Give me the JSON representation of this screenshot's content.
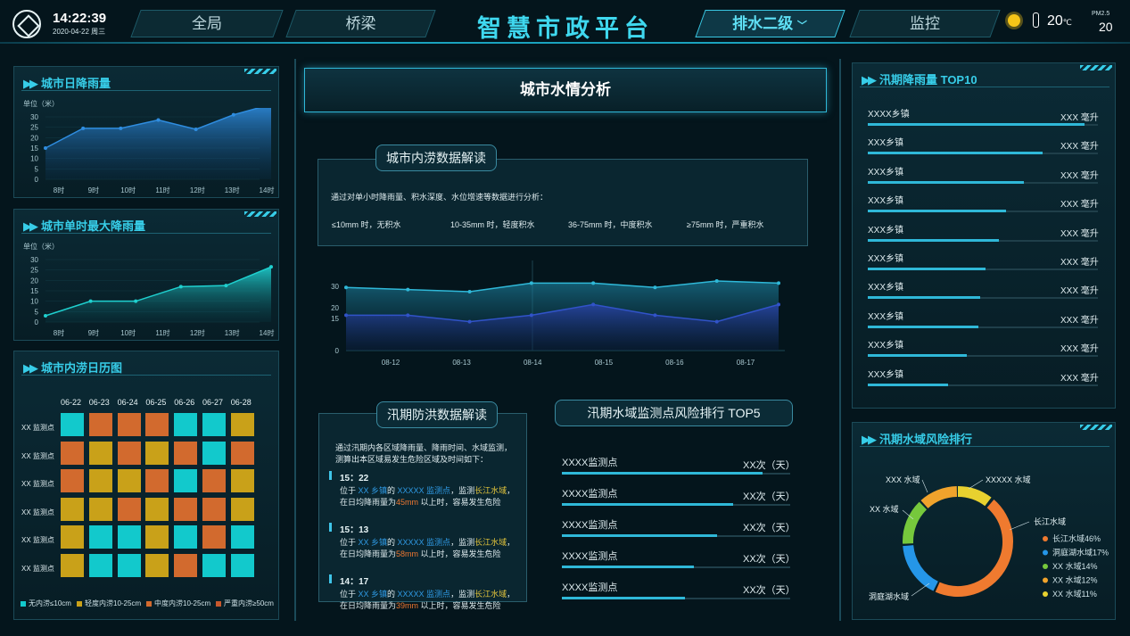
{
  "header": {
    "time": "14:22:39",
    "date": "2020-04-22 周三",
    "tabs": [
      "全局",
      "桥梁"
    ],
    "title": "智慧市政平台",
    "dropdown": "排水二级",
    "tab_right": "监控",
    "temp": "20",
    "temp_unit": "℃",
    "pm_label": "PM2.5",
    "pm_value": "20"
  },
  "rain_daily": {
    "title": "城市日降雨量",
    "unit": "单位（米）",
    "yticks": [
      "30",
      "25",
      "20",
      "15",
      "10",
      "5",
      "0"
    ],
    "x": [
      "8时",
      "9时",
      "10时",
      "11时",
      "12时",
      "13时",
      "14时"
    ],
    "values": [
      15,
      24.5,
      24.5,
      28.5,
      24,
      31,
      36
    ]
  },
  "rain_hourly": {
    "title": "城市单时最大降雨量",
    "unit": "单位（米）",
    "yticks": [
      "30",
      "25",
      "20",
      "15",
      "10",
      "5",
      "0"
    ],
    "x": [
      "8时",
      "9时",
      "10时",
      "11时",
      "12时",
      "13时",
      "14时"
    ],
    "values": [
      3,
      10,
      10,
      17,
      17.5,
      26.5
    ]
  },
  "calendar": {
    "title": "城市内涝日历图",
    "days": [
      "06-22",
      "06-23",
      "06-24",
      "06-25",
      "06-26",
      "06-27",
      "06-28"
    ],
    "rows": [
      "XX 监测点",
      "XX 监测点",
      "XX 监测点",
      "XX 监测点",
      "XX 监测点",
      "XX 监测点"
    ],
    "grid": [
      [
        0,
        2,
        2,
        2,
        0,
        0,
        1
      ],
      [
        2,
        1,
        2,
        1,
        2,
        0,
        2
      ],
      [
        2,
        1,
        1,
        2,
        0,
        2,
        1
      ],
      [
        1,
        1,
        2,
        1,
        2,
        2,
        1
      ],
      [
        1,
        0,
        0,
        1,
        0,
        2,
        0
      ],
      [
        1,
        0,
        0,
        1,
        2,
        0,
        0
      ]
    ],
    "colors": [
      "#12c9cc",
      "#c9a119",
      "#d26a2e",
      "#c7582d"
    ],
    "legend": [
      "无内涝≤10cm",
      "轻度内涝10-25cm",
      "中度内涝10-25cm",
      "严重内涝≥50cm"
    ],
    "legend_colors": [
      "#12c9cc",
      "#c9a119",
      "#d26a2e",
      "#c7582d"
    ]
  },
  "center": {
    "title": "城市水情分析",
    "analysis_tag": "城市内涝数据解读",
    "analysis_text": "通过对单小时降雨量、积水深度、水位增速等数据进行分析：",
    "levels": [
      "≤10mm 时，无积水",
      "10-35mm 时，轻度积水",
      "36-75mm 时，中度积水",
      "≥75mm 时，严重积水"
    ]
  },
  "center_chart": {
    "type": "line",
    "x": [
      "08-12",
      "08-13",
      "08-14",
      "08-15",
      "08-16",
      "08-17"
    ],
    "yticks": [
      "30",
      "20",
      "15",
      "0"
    ],
    "series": [
      {
        "values": [
          29.5,
          28.5,
          27.5,
          31.5,
          31.5,
          29.5,
          32.5,
          31.5
        ]
      },
      {
        "values": [
          16.5,
          16.5,
          13.5,
          16.5,
          21.5,
          16.5,
          13.5,
          21.5
        ]
      }
    ],
    "colors": [
      "#2fb8d8",
      "#3153c9"
    ]
  },
  "flood": {
    "tag": "汛期防洪数据解读",
    "intro1": "通过汛期内各区域降雨量、降雨时间、水域监测，",
    "intro2": "测算出本区域易发生危险区域及时间如下：",
    "events": [
      {
        "time": "15：22",
        "a": "位于 ",
        "town": "XX 乡镇",
        "b": "的 ",
        "point": "XXXXX 监测点",
        "c": "，监测",
        "river": "长江水域",
        "d": "，",
        "e": "在日均降雨量为",
        "mm": "45mm",
        "f": " 以上时，容易发生危险"
      },
      {
        "time": "15：13",
        "a": "位于 ",
        "town": "XX 乡镇",
        "b": "的 ",
        "point": "XXXXX 监测点",
        "c": "，监测",
        "river": "长江水域",
        "d": "，",
        "e": "在日均降雨量为",
        "mm": "58mm",
        "f": " 以上时，容易发生危险"
      },
      {
        "time": "14：17",
        "a": "位于 ",
        "town": "XX 乡镇",
        "b": "的 ",
        "point": "XXXXX 监测点",
        "c": "，监测",
        "river": "长江水域",
        "d": "，",
        "e": "在日均降雨量为",
        "mm": "39mm",
        "f": " 以上时，容易发生危险"
      }
    ]
  },
  "risk_top5": {
    "tag": "汛期水域监测点风险排行 TOP5",
    "items": [
      {
        "name": "XXXX监测点",
        "value": "XX次（天）",
        "pct": 0.88
      },
      {
        "name": "XXXX监测点",
        "value": "XX次（天）",
        "pct": 0.75
      },
      {
        "name": "XXXX监测点",
        "value": "XX次（天）",
        "pct": 0.68
      },
      {
        "name": "XXXX监测点",
        "value": "XX次（天）",
        "pct": 0.58
      },
      {
        "name": "XXXX监测点",
        "value": "XX次（天）",
        "pct": 0.54
      }
    ]
  },
  "rain_top10": {
    "title": "汛期降雨量 TOP10",
    "items": [
      {
        "name": "XXXX乡镇",
        "value": "XXX 毫升",
        "pct": 0.94
      },
      {
        "name": "XXX乡镇",
        "value": "XXX 毫升",
        "pct": 0.76
      },
      {
        "name": "XXX乡镇",
        "value": "XXX 毫升",
        "pct": 0.68
      },
      {
        "name": "XXX乡镇",
        "value": "XXX 毫升",
        "pct": 0.6
      },
      {
        "name": "XXX乡镇",
        "value": "XXX 毫升",
        "pct": 0.57
      },
      {
        "name": "XXX乡镇",
        "value": "XXX 毫升",
        "pct": 0.51
      },
      {
        "name": "XXX乡镇",
        "value": "XXX 毫升",
        "pct": 0.49
      },
      {
        "name": "XXX乡镇",
        "value": "XXX 毫升",
        "pct": 0.48
      },
      {
        "name": "XXX乡镇",
        "value": "XXX 毫升",
        "pct": 0.43
      },
      {
        "name": "XXX乡镇",
        "value": "XXX 毫升",
        "pct": 0.35
      }
    ]
  },
  "risk_pie": {
    "title": "汛期水域风险排行",
    "labels_on_chart": [
      "XXX 水域",
      "XXXXX 水域",
      "XX 水域",
      "长江水域",
      "洞庭湖水域"
    ],
    "legend": [
      "长江水域46%",
      "洞庭湖水域17%",
      "XX 水域14%",
      "XX 水域12%",
      "XX 水域11%"
    ],
    "values": [
      46,
      17,
      14,
      12,
      11
    ],
    "colors": [
      "#ef7a2f",
      "#2596e8",
      "#76c83c",
      "#f0a32c",
      "#e8d12f"
    ]
  }
}
